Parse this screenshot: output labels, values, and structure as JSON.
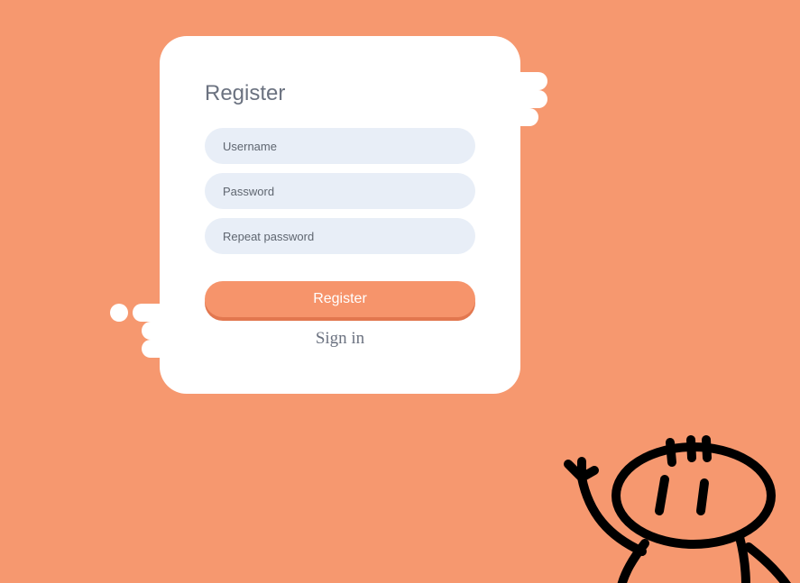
{
  "theme": {
    "background": "#f6986f",
    "accent": "#f6946b",
    "input_fill": "#e8eef7"
  },
  "form": {
    "title": "Register",
    "username_placeholder": "Username",
    "password_placeholder": "Password",
    "repeat_password_placeholder": "Repeat password",
    "submit_label": "Register",
    "signin_link": "Sign in"
  },
  "decorations": {
    "character": "waving-doodle-icon",
    "clouds": "speech-cloud-icon"
  }
}
